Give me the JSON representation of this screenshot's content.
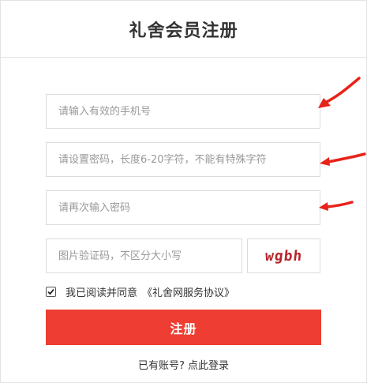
{
  "page": {
    "title": "礼舍会员注册"
  },
  "form": {
    "phone_placeholder": "请输入有效的手机号",
    "password_placeholder": "请设置密码，长度6-20字符，不能有特殊字符",
    "confirm_placeholder": "请再次输入密码",
    "captcha_placeholder": "图片验证码，不区分大小写",
    "captcha_text": "wgbh",
    "agree_checked": true,
    "agree_text": "我已阅读并同意",
    "agreement_link": "《礼舍网服务协议》",
    "submit_label": "注册",
    "login_prompt": "已有账号?",
    "login_link": "点此登录"
  },
  "colors": {
    "accent": "#ee3d32",
    "annotation_arrow": "#e8231a",
    "captcha": "#b5262b"
  },
  "icons": {
    "checkbox": "checkmark-icon",
    "annotation": "arrow-icon"
  }
}
